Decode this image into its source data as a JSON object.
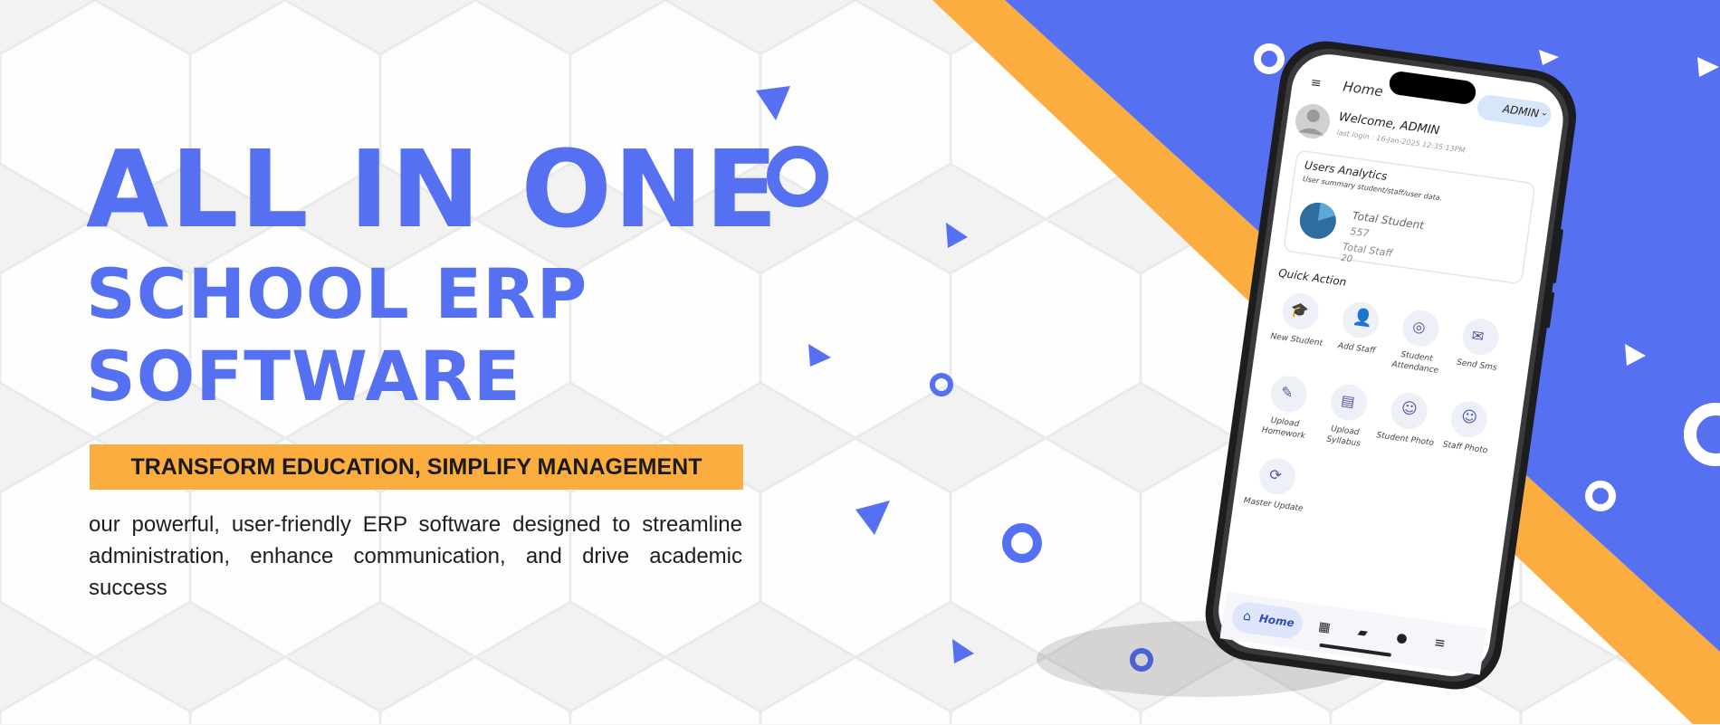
{
  "hero": {
    "line1": "ALL IN ONE",
    "line2": "SCHOOL ERP",
    "line3": "SOFTWARE",
    "tagline": "TRANSFORM EDUCATION, SIMPLIFY MANAGEMENT",
    "description": "our powerful, user-friendly ERP software designed to streamline administration, enhance communication, and drive academic success"
  },
  "colors": {
    "brand_blue": "#5570f0",
    "accent_orange": "#fbad3f"
  },
  "phone": {
    "header": {
      "menu_icon": "hamburger-icon",
      "title": "Home",
      "role": "ADMIN"
    },
    "welcome": {
      "greeting": "Welcome, ADMIN",
      "last_login": "last login : 16-Jan-2025 12:35:13PM"
    },
    "analytics": {
      "title": "Users Analytics",
      "subtitle": "User summary student/staff/user data.",
      "student_label": "Total Student",
      "student_value": "557",
      "staff_label": "Total Staff",
      "staff_value": "20"
    },
    "quick_action_title": "Quick Action",
    "quick_actions": [
      {
        "label": "New Student",
        "icon": "graduation-cap-icon"
      },
      {
        "label": "Add Staff",
        "icon": "add-user-icon"
      },
      {
        "label": "Student Attendance",
        "icon": "fingerprint-icon"
      },
      {
        "label": "Send Sms",
        "icon": "mail-icon"
      },
      {
        "label": "Upload Homework",
        "icon": "homework-icon"
      },
      {
        "label": "Upload Syllabus",
        "icon": "clipboard-icon"
      },
      {
        "label": "Student Photo",
        "icon": "student-icon"
      },
      {
        "label": "Staff Photo",
        "icon": "staff-icon"
      },
      {
        "label": "Master Update",
        "icon": "update-icon"
      }
    ],
    "bottom_nav": {
      "home_label": "Home"
    }
  }
}
